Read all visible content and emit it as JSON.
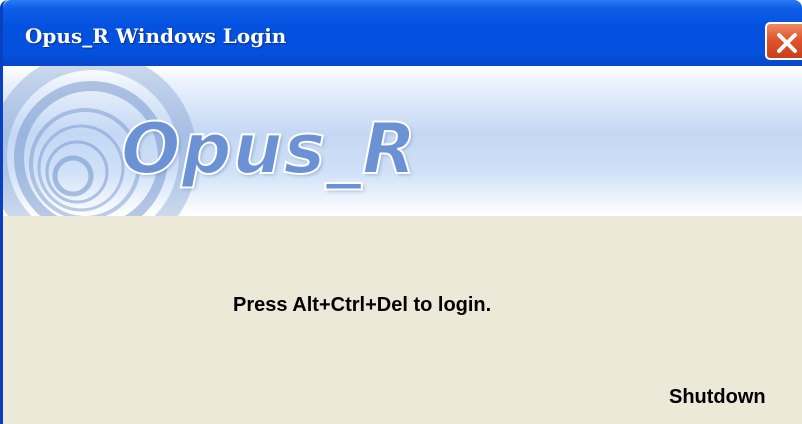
{
  "window": {
    "title": "Opus_R Windows Login",
    "close_icon": "close-icon"
  },
  "banner": {
    "logo_text": "Opus_R",
    "logo_icon": "swirl-logo-icon"
  },
  "content": {
    "message": "Press Alt+Ctrl+Del to login.",
    "shutdown_label": "Shutdown"
  },
  "colors": {
    "titlebar": "#0451e0",
    "close_button": "#e0552d",
    "dialog_background": "#ece9d8",
    "logo_text": "#6b92d4"
  }
}
